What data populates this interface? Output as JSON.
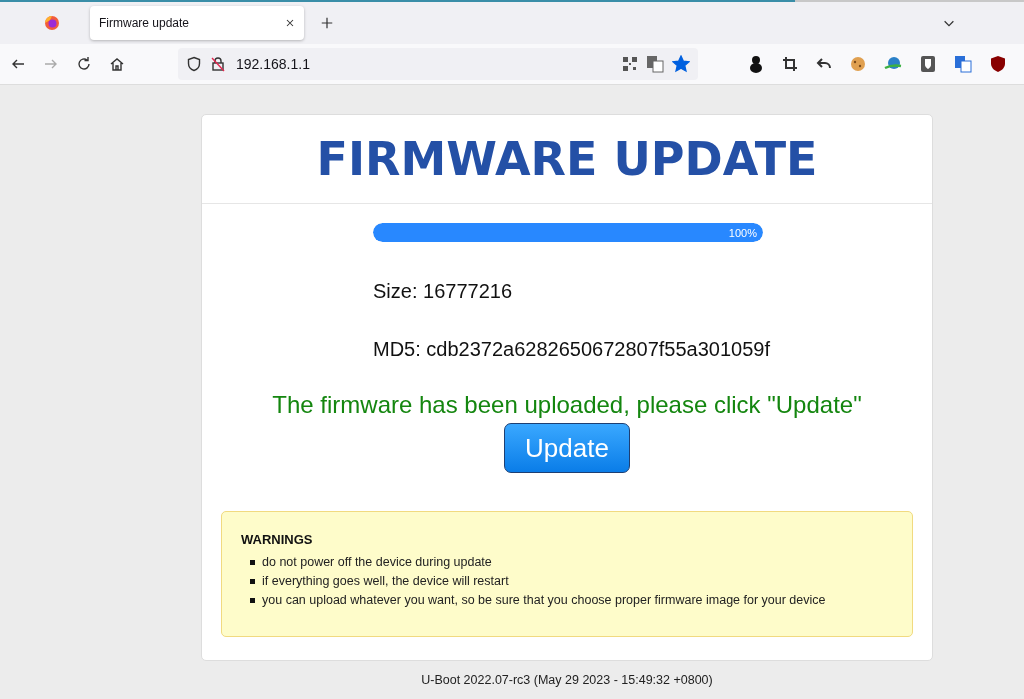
{
  "browser": {
    "tabs": [
      {
        "title": "Firmware update",
        "selected": true
      }
    ],
    "url": "192.168.1.1",
    "bookmarked": true
  },
  "page": {
    "title": "FIRMWARE UPDATE",
    "progress": {
      "level": 1,
      "reading": "100%"
    },
    "size": "Size: 16777216",
    "md5": "MD5: cdb2372a6282650672807f55a301059f",
    "message": "The firmware has been uploaded, please click \"Update\"",
    "button": "Update",
    "warnings": {
      "title": "WARNINGS",
      "items": [
        "do not power off the device during update",
        "if everything goes well, the device will restart",
        "you can upload whatever you want, so be sure that you choose proper firmware image for your device"
      ]
    },
    "footer": "U-Boot 2022.07-rc3 (May 29 2023 - 15:49:32 +0800)"
  }
}
